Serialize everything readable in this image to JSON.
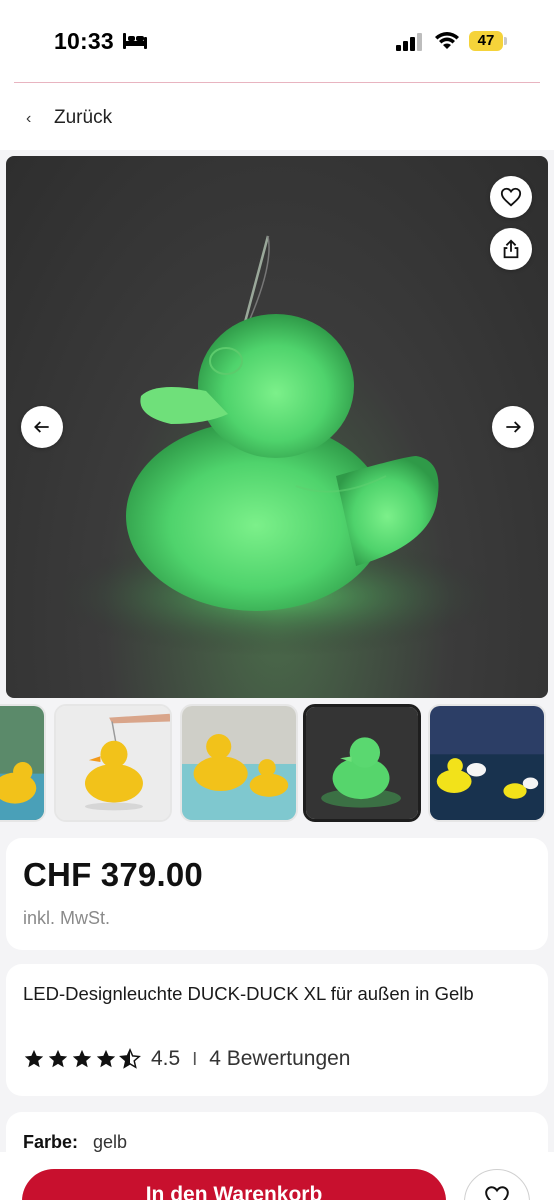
{
  "status_bar": {
    "time": "10:33",
    "battery": "47",
    "icons": [
      "bed-icon",
      "signal-icon",
      "wifi-icon",
      "battery-icon"
    ]
  },
  "nav": {
    "back_label": "Zurück",
    "back_icon": "chevron-left-icon"
  },
  "gallery": {
    "main_image": "glowing green LED duck lamp on dark background",
    "actions": [
      "heart-icon",
      "share-icon",
      "arrow-left-icon",
      "arrow-right-icon"
    ],
    "thumbnails": [
      {
        "desc": "yellow duck at poolside"
      },
      {
        "desc": "hand holding yellow duck lamp"
      },
      {
        "desc": "two yellow ducks in pool"
      },
      {
        "desc": "green glowing duck",
        "active": true
      },
      {
        "desc": "glowing ducks in pool at dusk"
      }
    ]
  },
  "product": {
    "price": "CHF 379.00",
    "vat_note": "inkl. MwSt.",
    "title": "LED-Designleuchte DUCK-DUCK XL für außen in Gelb",
    "rating_value": "4.5",
    "rating_separator": "I",
    "rating_count": "4 Bewertungen",
    "color_label": "Farbe:",
    "color_value": "gelb"
  },
  "actions": {
    "add_to_cart": "In den Warenkorb"
  },
  "colors": {
    "brand_red": "#c8102e",
    "battery_yellow": "#f5d33a",
    "duck_green": "#4fd36c"
  }
}
